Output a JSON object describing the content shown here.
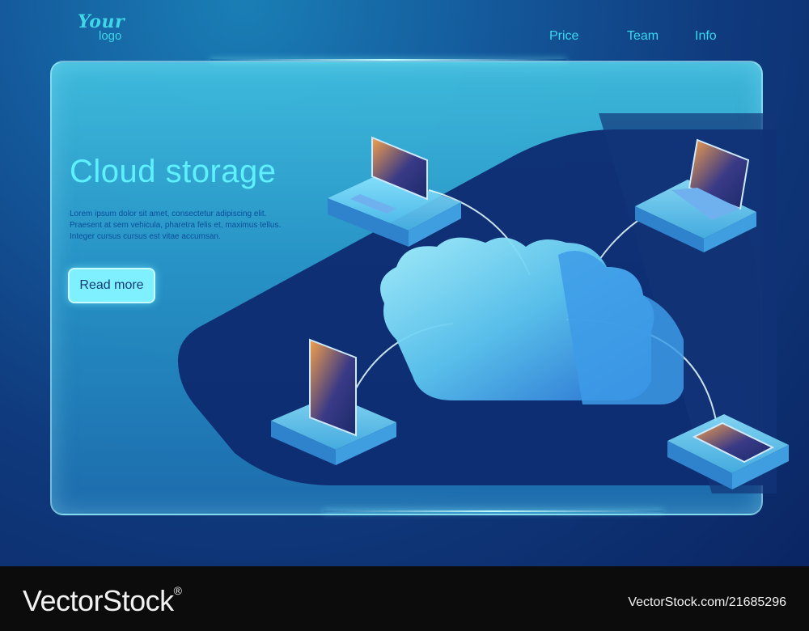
{
  "logo": {
    "line1": "Your",
    "line2": "logo"
  },
  "nav": {
    "items": [
      "Price",
      "Team",
      "Info"
    ]
  },
  "hero": {
    "title": "Cloud storage",
    "body_lines": [
      "Lorem ipsum dolor sit amet, consectetur adipiscing elit.",
      "Praesent at sem vehicula, pharetra felis et, maximus tellus.",
      "Integer cursus cursus est vitae accumsan."
    ],
    "button_label": "Read more"
  },
  "watermark": {
    "brand": "VectorStock",
    "registered": "®",
    "id_text": "VectorStock.com/21685296"
  },
  "colors": {
    "accent": "#5ef0ff",
    "nav": "#3ad8ee",
    "button": "#7ff0ff",
    "body_text": "#0b4f9a"
  },
  "illustration": {
    "icons": [
      "cloud-icon",
      "desktop-computer-icon",
      "laptop-icon",
      "smartphone-icon",
      "tablet-icon"
    ]
  }
}
